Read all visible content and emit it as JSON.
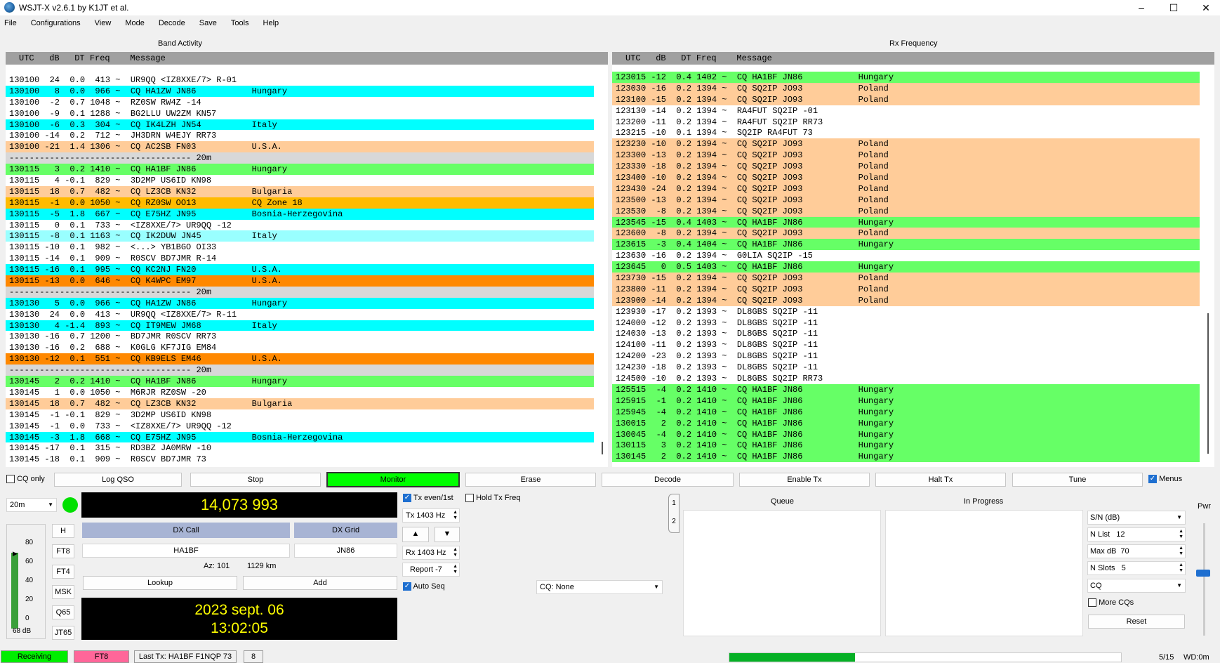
{
  "window": {
    "title": "WSJT-X   v2.6.1   by K1JT et al.",
    "min": "–",
    "max": "☐",
    "close": "✕"
  },
  "menu": [
    "File",
    "Configurations",
    "View",
    "Mode",
    "Decode",
    "Save",
    "Tools",
    "Help"
  ],
  "band_activity": {
    "label": "Band Activity",
    "header": "UTC   dB   DT Freq    Message",
    "rows": [
      {
        "t": "130100  24  0.0  413 ~  UR9QQ <IZ8XXE/7> R-01",
        "bg": "#ffffff"
      },
      {
        "t": "130100   8  0.0  966 ~  CQ HA1ZW JN86           Hungary",
        "bg": "#00ffff"
      },
      {
        "t": "130100  -2  0.7 1048 ~  RZ0SW RW4Z -14",
        "bg": "#ffffff"
      },
      {
        "t": "130100  -9  0.1 1288 ~  BG2LLU UW2ZM KN57",
        "bg": "#ffffff"
      },
      {
        "t": "130100  -6  0.3  304 ~  CQ IK4LZH JN54          Italy",
        "bg": "#00ffff"
      },
      {
        "t": "130100 -14  0.2  712 ~  JH3DRN W4EJY RR73",
        "bg": "#ffffff"
      },
      {
        "t": "130100 -21  1.4 1306 ~  CQ AC2SB FN03           U.S.A.",
        "bg": "#ffcc99"
      },
      {
        "t": "------------------------------------ 20m",
        "bg": "#d8d8d8"
      },
      {
        "t": "130115   3  0.2 1410 ~  CQ HA1BF JN86           Hungary",
        "bg": "#66ff66"
      },
      {
        "t": "130115   4 -0.1  829 ~  3D2MP US6ID KN98",
        "bg": "#ffffff"
      },
      {
        "t": "130115  18  0.7  482 ~  CQ LZ3CB KN32           Bulgaria",
        "bg": "#ffcc99"
      },
      {
        "t": "130115  -1  0.0 1050 ~  CQ RZ0SW OO13           CQ Zone 18",
        "bg": "#ffbb00"
      },
      {
        "t": "130115  -5  1.8  667 ~  CQ E75HZ JN95           Bosnia-Herzegovina",
        "bg": "#00ffff"
      },
      {
        "t": "130115   0  0.1  733 ~  <IZ8XXE/7> UR9QQ -12",
        "bg": "#ffffff"
      },
      {
        "t": "130115  -8  0.1 1163 ~  CQ IK2DUW JN45          Italy",
        "bg": "#99ffff"
      },
      {
        "t": "130115 -10  0.1  982 ~  <...> YB1BGO OI33",
        "bg": "#ffffff"
      },
      {
        "t": "130115 -14  0.1  909 ~  R0SCV BD7JMR R-14",
        "bg": "#ffffff"
      },
      {
        "t": "130115 -16  0.1  995 ~  CQ KC2NJ FN20           U.S.A.",
        "bg": "#00ffff"
      },
      {
        "t": "130115 -13  0.0  646 ~  CQ K4WPC EM97           U.S.A.",
        "bg": "#ff8800"
      },
      {
        "t": "------------------------------------ 20m",
        "bg": "#d8d8d8"
      },
      {
        "t": "130130   5  0.0  966 ~  CQ HA1ZW JN86           Hungary",
        "bg": "#00ffff"
      },
      {
        "t": "130130  24  0.0  413 ~  UR9QQ <IZ8XXE/7> R-11",
        "bg": "#ffffff"
      },
      {
        "t": "130130   4 -1.4  893 ~  CQ IT9MEW JM68          Italy",
        "bg": "#00ffff"
      },
      {
        "t": "130130 -16  0.7 1200 ~  BD7JMR R0SCV RR73",
        "bg": "#ffffff"
      },
      {
        "t": "130130 -16  0.2  688 ~  K0GLG KF7JIG EM84",
        "bg": "#ffffff"
      },
      {
        "t": "130130 -12  0.1  551 ~  CQ KB9ELS EM46          U.S.A.",
        "bg": "#ff8800"
      },
      {
        "t": "------------------------------------ 20m",
        "bg": "#d8d8d8"
      },
      {
        "t": "130145   2  0.2 1410 ~  CQ HA1BF JN86           Hungary",
        "bg": "#66ff66"
      },
      {
        "t": "130145   1  0.0 1050 ~  M6RJR RZ0SW -20",
        "bg": "#ffffff"
      },
      {
        "t": "130145  18  0.7  482 ~  CQ LZ3CB KN32           Bulgaria",
        "bg": "#ffcc99"
      },
      {
        "t": "130145  -1 -0.1  829 ~  3D2MP US6ID KN98",
        "bg": "#ffffff"
      },
      {
        "t": "130145  -1  0.0  733 ~  <IZ8XXE/7> UR9QQ -12",
        "bg": "#ffffff"
      },
      {
        "t": "130145  -3  1.8  668 ~  CQ E75HZ JN95           Bosnia-Herzegovina",
        "bg": "#00ffff"
      },
      {
        "t": "130145 -17  0.1  315 ~  RD3BZ JA0MRW -10",
        "bg": "#ffffff"
      },
      {
        "t": "130145 -18  0.1  909 ~  R0SCV BD7JMR 73",
        "bg": "#ffffff"
      }
    ]
  },
  "rx_frequency": {
    "label": "Rx Frequency",
    "header": "UTC   dB   DT Freq    Message",
    "rows": [
      {
        "t": "123015 -12  0.4 1402 ~  CQ HA1BF JN86           Hungary",
        "bg": "#66ff66"
      },
      {
        "t": "123030 -16  0.2 1394 ~  CQ SQ2IP JO93           Poland",
        "bg": "#ffcc99"
      },
      {
        "t": "123100 -15  0.2 1394 ~  CQ SQ2IP JO93           Poland",
        "bg": "#ffcc99"
      },
      {
        "t": "123130 -14  0.2 1394 ~  RA4FUT SQ2IP -01",
        "bg": "#ffffff"
      },
      {
        "t": "123200 -11  0.2 1394 ~  RA4FUT SQ2IP RR73",
        "bg": "#ffffff"
      },
      {
        "t": "123215 -10  0.1 1394 ~  SQ2IP RA4FUT 73",
        "bg": "#ffffff"
      },
      {
        "t": "123230 -10  0.2 1394 ~  CQ SQ2IP JO93           Poland",
        "bg": "#ffcc99"
      },
      {
        "t": "123300 -13  0.2 1394 ~  CQ SQ2IP JO93           Poland",
        "bg": "#ffcc99"
      },
      {
        "t": "123330 -18  0.2 1394 ~  CQ SQ2IP JO93           Poland",
        "bg": "#ffcc99"
      },
      {
        "t": "123400 -10  0.2 1394 ~  CQ SQ2IP JO93           Poland",
        "bg": "#ffcc99"
      },
      {
        "t": "123430 -24  0.2 1394 ~  CQ SQ2IP JO93           Poland",
        "bg": "#ffcc99"
      },
      {
        "t": "123500 -13  0.2 1394 ~  CQ SQ2IP JO93           Poland",
        "bg": "#ffcc99"
      },
      {
        "t": "123530  -8  0.2 1394 ~  CQ SQ2IP JO93           Poland",
        "bg": "#ffcc99"
      },
      {
        "t": "123545 -15  0.4 1403 ~  CQ HA1BF JN86           Hungary",
        "bg": "#66ff66"
      },
      {
        "t": "123600  -8  0.2 1394 ~  CQ SQ2IP JO93           Poland",
        "bg": "#ffcc99"
      },
      {
        "t": "123615  -3  0.4 1404 ~  CQ HA1BF JN86           Hungary",
        "bg": "#66ff66"
      },
      {
        "t": "123630 -16  0.2 1394 ~  G0LIA SQ2IP -15",
        "bg": "#ffffff"
      },
      {
        "t": "123645   0  0.5 1403 ~  CQ HA1BF JN86           Hungary",
        "bg": "#66ff66"
      },
      {
        "t": "123730 -15  0.2 1394 ~  CQ SQ2IP JO93           Poland",
        "bg": "#ffcc99"
      },
      {
        "t": "123800 -11  0.2 1394 ~  CQ SQ2IP JO93           Poland",
        "bg": "#ffcc99"
      },
      {
        "t": "123900 -14  0.2 1394 ~  CQ SQ2IP JO93           Poland",
        "bg": "#ffcc99"
      },
      {
        "t": "123930 -17  0.2 1393 ~  DL8GBS SQ2IP -11",
        "bg": "#ffffff"
      },
      {
        "t": "124000 -12  0.2 1393 ~  DL8GBS SQ2IP -11",
        "bg": "#ffffff"
      },
      {
        "t": "124030 -13  0.2 1393 ~  DL8GBS SQ2IP -11",
        "bg": "#ffffff"
      },
      {
        "t": "124100 -11  0.2 1393 ~  DL8GBS SQ2IP -11",
        "bg": "#ffffff"
      },
      {
        "t": "124200 -23  0.2 1393 ~  DL8GBS SQ2IP -11",
        "bg": "#ffffff"
      },
      {
        "t": "124230 -18  0.2 1393 ~  DL8GBS SQ2IP -11",
        "bg": "#ffffff"
      },
      {
        "t": "124500 -10  0.2 1393 ~  DL8GBS SQ2IP RR73",
        "bg": "#ffffff"
      },
      {
        "t": "125515  -4  0.2 1410 ~  CQ HA1BF JN86           Hungary",
        "bg": "#66ff66"
      },
      {
        "t": "125915  -1  0.2 1410 ~  CQ HA1BF JN86           Hungary",
        "bg": "#66ff66"
      },
      {
        "t": "125945  -4  0.2 1410 ~  CQ HA1BF JN86           Hungary",
        "bg": "#66ff66"
      },
      {
        "t": "130015   2  0.2 1410 ~  CQ HA1BF JN86           Hungary",
        "bg": "#66ff66"
      },
      {
        "t": "130045  -4  0.2 1410 ~  CQ HA1BF JN86           Hungary",
        "bg": "#66ff66"
      },
      {
        "t": "130115   3  0.2 1410 ~  CQ HA1BF JN86           Hungary",
        "bg": "#66ff66"
      },
      {
        "t": "130145   2  0.2 1410 ~  CQ HA1BF JN86           Hungary",
        "bg": "#66ff66"
      }
    ]
  },
  "controls": {
    "cq_only": "CQ only",
    "log_qso": "Log QSO",
    "stop": "Stop",
    "monitor": "Monitor",
    "erase": "Erase",
    "decode": "Decode",
    "enable_tx": "Enable Tx",
    "halt_tx": "Halt Tx",
    "tune": "Tune",
    "menus": "Menus"
  },
  "band": "20m",
  "frequency": "14,073 993",
  "modes": [
    "H",
    "FT8",
    "FT4",
    "MSK",
    "Q65",
    "JT65"
  ],
  "meter": {
    "ticks": [
      "80",
      "60",
      "40",
      "20",
      "0"
    ],
    "level_db": "68 dB"
  },
  "dx": {
    "call_label": "DX Call",
    "grid_label": "DX Grid",
    "call": "HA1BF",
    "grid": "JN86",
    "az": "Az: 101",
    "dist": "1129 km",
    "lookup": "Lookup",
    "add": "Add"
  },
  "clock": {
    "date": "2023 sept. 06",
    "time": "13:02:05"
  },
  "tx": {
    "even_first": "Tx even/1st",
    "hold_tx_freq": "Hold Tx Freq",
    "tx_freq": "Tx  1403  Hz",
    "rx_freq": "Rx  1403  Hz",
    "report": "Report -7",
    "auto_seq": "Auto Seq",
    "cq_select": "CQ: None",
    "up": "▲",
    "down": "▼"
  },
  "tabs": [
    "1",
    "2"
  ],
  "queue": {
    "queue_label": "Queue",
    "progress_label": "In Progress"
  },
  "fox": {
    "sn": "S/N (dB)",
    "nlist_label": "N List",
    "nlist": "12",
    "maxdb_label": "Max dB",
    "maxdb": "70",
    "nslots_label": "N Slots",
    "nslots": "5",
    "cq": "CQ",
    "more_cqs": "More CQs",
    "reset": "Reset"
  },
  "pwr": "Pwr",
  "status": {
    "receiving": "Receiving",
    "mode": "FT8",
    "last_tx": "Last Tx: HA1BF F1NQP 73",
    "n": "8",
    "progress": "5/15",
    "wd": "WD:0m"
  }
}
